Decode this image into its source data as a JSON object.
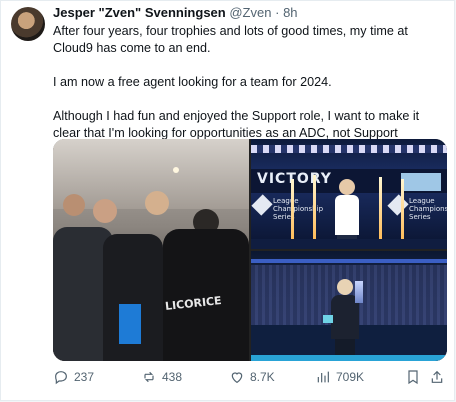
{
  "tweet": {
    "display_name": "Jesper \"Zven\" Svenningsen",
    "handle": "@Zven",
    "separator": "·",
    "time": "8h",
    "paragraphs": [
      "After four years, four trophies and lots of good times, my time at Cloud9 has come to an end.",
      "I am now a free agent looking for a team for 2024.",
      "Although I had fun and enjoyed the Support role, I want to make it clear that I'm looking for opportunities as an ADC, not Support"
    ]
  },
  "media": {
    "left_shirt_text": "LICORICE",
    "stage_banner": "VICTORY",
    "event_logo_lines": [
      "League",
      "Championship",
      "Series"
    ]
  },
  "actions": {
    "replies": "237",
    "reposts": "438",
    "likes": "8.7K",
    "views": "709K"
  },
  "colors": {
    "text": "#0f1419",
    "muted": "#536471",
    "accent": "#1d9bf0"
  }
}
